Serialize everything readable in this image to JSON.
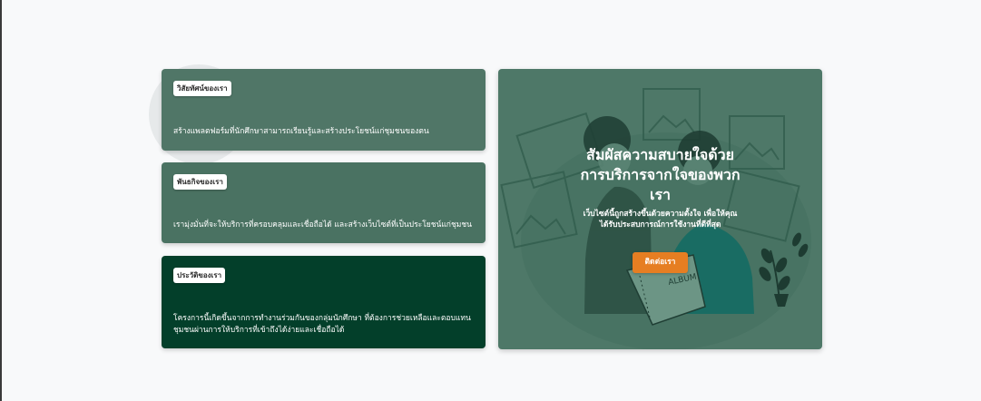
{
  "cards": [
    {
      "tag": "วิสัยทัศน์ของเรา",
      "text": "สร้างแพลตฟอร์มที่นักศึกษาสามารถเรียนรู้และสร้างประโยชน์แก่ชุมชนของตน"
    },
    {
      "tag": "พันธกิจของเรา",
      "text": "เรามุ่งมั่นที่จะให้บริการที่ครอบคลุมและเชื่อถือได้ และสร้างเว็บไซต์ที่เป็นประโยชน์แก่ชุมชน"
    },
    {
      "tag": "ประวัติของเรา",
      "text": "โครงการนี้เกิดขึ้นจากการทำงานร่วมกันของกลุ่มนักศึกษา ที่ต้องการช่วยเหลือและตอบแทนชุมชนผ่านการให้บริการที่เข้าถึงได้ง่ายและเชื่อถือได้"
    }
  ],
  "hero": {
    "title": "สัมผัสความสบายใจด้วยการบริการจากใจของพวกเรา",
    "subtitle": "เว็บไซต์นี้ถูกสร้างขึ้นด้วยความตั้งใจ เพื่อให้คุณได้รับประสบการณ์การใช้งานที่ดีที่สุด",
    "button_label": "ติดต่อเรา",
    "illustration_label": "ALBUM",
    "accent_color": "#e67e22"
  },
  "colors": {
    "card_green": "#4a7262",
    "card_dark": "#033f2a",
    "page_bg": "#f8f9fa"
  }
}
